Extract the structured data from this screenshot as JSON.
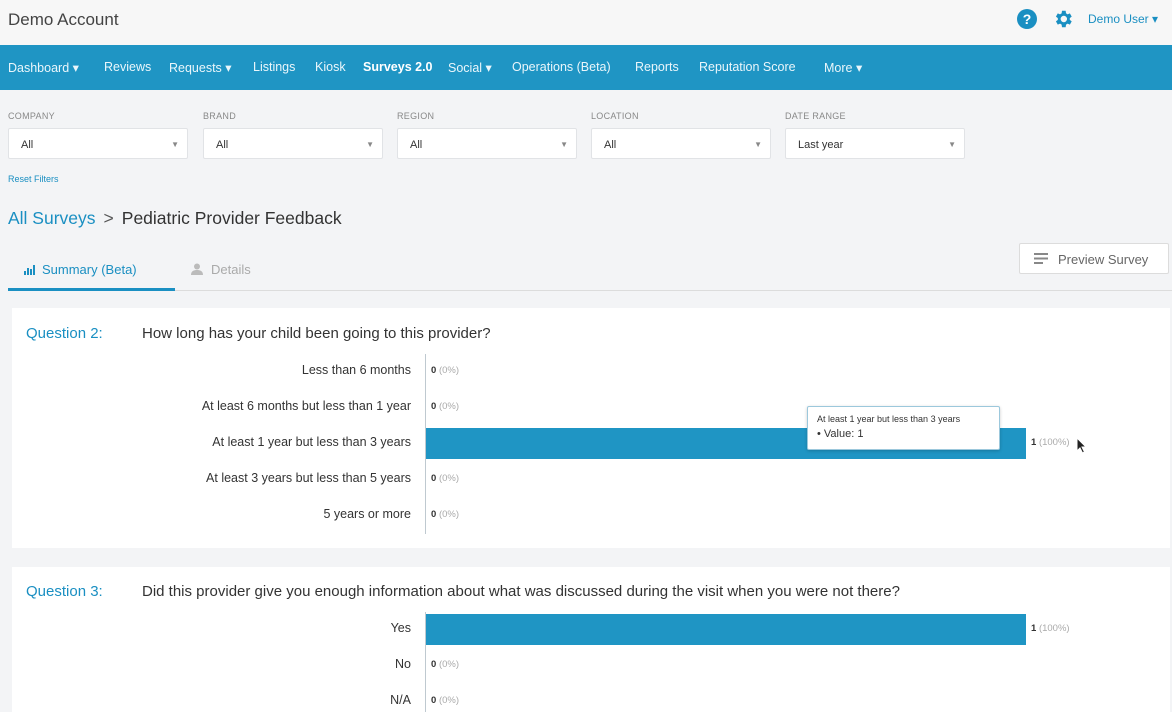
{
  "header": {
    "account": "Demo Account",
    "user": "Demo User",
    "help_icon": "help-circle-icon",
    "settings_icon": "gear-icon",
    "help_glyph": "?"
  },
  "nav": {
    "items": [
      "Dashboard ▾",
      "Reviews",
      "Requests ▾",
      "Listings",
      "Kiosk",
      "Surveys 2.0",
      "Social ▾",
      "Operations (Beta)",
      "Reports",
      "Reputation Score",
      "More ▾"
    ],
    "active": "Surveys 2.0"
  },
  "filters": [
    {
      "label": "COMPANY",
      "value": "All"
    },
    {
      "label": "BRAND",
      "value": "All"
    },
    {
      "label": "REGION",
      "value": "All"
    },
    {
      "label": "LOCATION",
      "value": "All"
    },
    {
      "label": "DATE RANGE",
      "value": "Last year"
    }
  ],
  "reset_filters": "Reset Filters",
  "breadcrumb": {
    "parent": "All Surveys",
    "separator": ">",
    "current": "Pediatric Provider Feedback"
  },
  "tabs": {
    "summary": "Summary (Beta)",
    "details": "Details"
  },
  "preview_button": "Preview Survey",
  "questions": [
    {
      "number": "Question 2:",
      "text": "How long has your child been going to this provider?",
      "answers": [
        {
          "label": "Less than 6 months",
          "count": "0",
          "pct": "(0%)"
        },
        {
          "label": "At least 6 months but less than 1 year",
          "count": "0",
          "pct": "(0%)"
        },
        {
          "label": "At least 1 year but less than 3 years",
          "count": "1",
          "pct": "(100%)"
        },
        {
          "label": "At least 3 years but less than 5 years",
          "count": "0",
          "pct": "(0%)"
        },
        {
          "label": "5 years or more",
          "count": "0",
          "pct": "(0%)"
        }
      ]
    },
    {
      "number": "Question 3:",
      "text": "Did this provider give you enough information about what was discussed during the visit when you were not there?",
      "answers": [
        {
          "label": "Yes",
          "count": "1",
          "pct": "(100%)"
        },
        {
          "label": "No",
          "count": "0",
          "pct": "(0%)"
        },
        {
          "label": "N/A",
          "count": "0",
          "pct": "(0%)"
        }
      ]
    }
  ],
  "tooltip": {
    "title": "At least 1 year but less than 3 years",
    "value_label": "• Value: 1"
  },
  "chart_data": [
    {
      "type": "bar",
      "orientation": "horizontal",
      "categories": [
        "Less than 6 months",
        "At least 6 months but less than 1 year",
        "At least 1 year but less than 3 years",
        "At least 3 years but less than 5 years",
        "5 years or more"
      ],
      "values": [
        0,
        0,
        1,
        0,
        0
      ],
      "percentages": [
        0,
        0,
        100,
        0,
        0
      ]
    },
    {
      "type": "bar",
      "orientation": "horizontal",
      "categories": [
        "Yes",
        "No",
        "N/A"
      ],
      "values": [
        1,
        0,
        0
      ],
      "percentages": [
        100,
        0,
        0
      ]
    }
  ],
  "colors": {
    "accent": "#1f95c4",
    "link": "#1a8fc2"
  }
}
